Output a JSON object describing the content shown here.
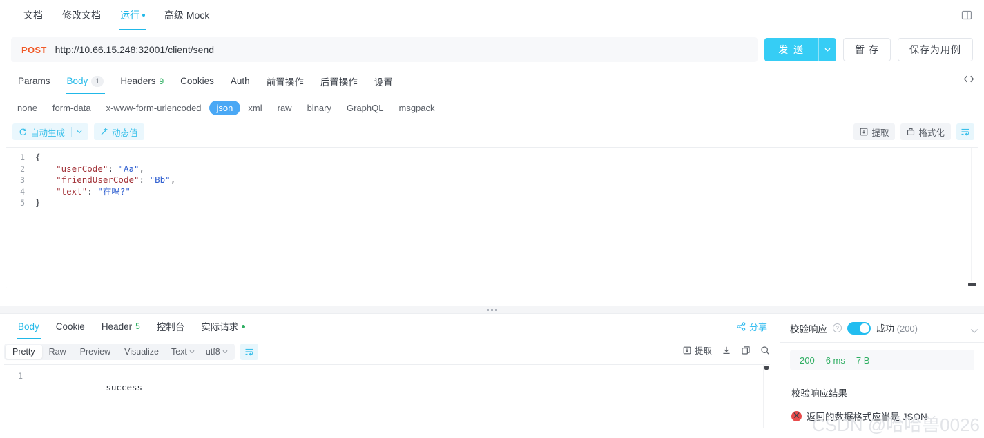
{
  "topbar": {
    "tabs": [
      {
        "label": "文档",
        "active": false,
        "dot": false
      },
      {
        "label": "修改文档",
        "active": false,
        "dot": false
      },
      {
        "label": "运行",
        "active": true,
        "dot": true
      },
      {
        "label": "高级 Mock",
        "active": false,
        "dot": false
      }
    ],
    "panel_toggle_icon": "split-panel-icon"
  },
  "url_row": {
    "method": "POST",
    "url": "http://10.66.15.248:32001/client/send",
    "send_label": "发 送",
    "send_dropdown_icon": "chevron-down-icon",
    "stash_label": "暂 存",
    "save_case_label": "保存为用例"
  },
  "request_tabs": {
    "tabs": [
      {
        "label": "Params",
        "badge": "",
        "badge_type": "",
        "active": false
      },
      {
        "label": "Body",
        "badge": "1",
        "badge_type": "grey",
        "active": true
      },
      {
        "label": "Headers",
        "badge": "9",
        "badge_type": "green",
        "active": false
      },
      {
        "label": "Cookies",
        "badge": "",
        "badge_type": "",
        "active": false
      },
      {
        "label": "Auth",
        "badge": "",
        "badge_type": "",
        "active": false
      },
      {
        "label": "前置操作",
        "badge": "",
        "badge_type": "",
        "active": false
      },
      {
        "label": "后置操作",
        "badge": "",
        "badge_type": "",
        "active": false
      },
      {
        "label": "设置",
        "badge": "",
        "badge_type": "",
        "active": false
      }
    ],
    "code_icon": "code-brackets-icon"
  },
  "body_types": [
    {
      "label": "none",
      "selected": false
    },
    {
      "label": "form-data",
      "selected": false
    },
    {
      "label": "x-www-form-urlencoded",
      "selected": false
    },
    {
      "label": "json",
      "selected": true
    },
    {
      "label": "xml",
      "selected": false
    },
    {
      "label": "raw",
      "selected": false
    },
    {
      "label": "binary",
      "selected": false
    },
    {
      "label": "GraphQL",
      "selected": false
    },
    {
      "label": "msgpack",
      "selected": false
    }
  ],
  "editor_toolbar": {
    "auto_generate_label": "自动生成",
    "auto_generate_icon": "refresh-icon",
    "auto_generate_caret": "chevron-down-icon",
    "dynamic_value_label": "动态值",
    "dynamic_value_icon": "magic-wand-icon",
    "extract_label": "提取",
    "extract_icon": "extract-icon",
    "format_label": "格式化",
    "format_icon": "format-icon",
    "wrap_icon": "text-wrap-icon"
  },
  "request_body": {
    "lines": [
      {
        "num": "1",
        "open": "{"
      },
      {
        "num": "2",
        "key": "\"userCode\"",
        "value": "\"Aa\"",
        "tail": ","
      },
      {
        "num": "3",
        "key": "\"friendUserCode\"",
        "value": "\"Bb\"",
        "tail": ","
      },
      {
        "num": "4",
        "key": "\"text\"",
        "value": "\"在吗?\"",
        "tail": ""
      },
      {
        "num": "5",
        "close": "}"
      }
    ]
  },
  "response_tabs": {
    "tabs": [
      {
        "label": "Body",
        "badge": "",
        "active": true,
        "dot": false
      },
      {
        "label": "Cookie",
        "badge": "",
        "active": false,
        "dot": false
      },
      {
        "label": "Header",
        "badge": "5",
        "active": false,
        "dot": false
      },
      {
        "label": "控制台",
        "badge": "",
        "active": false,
        "dot": false
      },
      {
        "label": "实际请求",
        "badge": "",
        "active": false,
        "dot": true
      }
    ],
    "share_label": "分享",
    "share_icon": "share-icon"
  },
  "response_toolbar": {
    "segments": [
      {
        "label": "Pretty",
        "selected": true
      },
      {
        "label": "Raw",
        "selected": false
      },
      {
        "label": "Preview",
        "selected": false
      },
      {
        "label": "Visualize",
        "selected": false
      }
    ],
    "type_select": "Text",
    "encoding_select": "utf8",
    "wrap_icon": "text-wrap-icon",
    "extract_label": "提取",
    "extract_icon": "extract-icon",
    "download_icon": "download-icon",
    "copy_icon": "copy-icon",
    "search_icon": "search-icon"
  },
  "response_body": {
    "lines": [
      {
        "num": "1",
        "text": "success"
      }
    ]
  },
  "verify_panel": {
    "title": "校验响应",
    "help_icon": "question-mark-icon",
    "toggle_on": true,
    "status": "成功",
    "status_code": "(200)",
    "collapse_icon": "chevron-down-icon",
    "metrics": [
      "200",
      "6 ms",
      "7 B"
    ],
    "result_title": "校验响应结果",
    "error_icon": "error-circle-icon",
    "error_text": "返回的数据格式应当是 JSON"
  },
  "watermark": "CSDN @哈哈兽0026",
  "colors": {
    "accent": "#21b8e8",
    "send": "#36cdf5",
    "method": "#f05a28",
    "json_pill": "#4aa8f5",
    "success": "#2fae62",
    "error": "#e84b4b"
  }
}
